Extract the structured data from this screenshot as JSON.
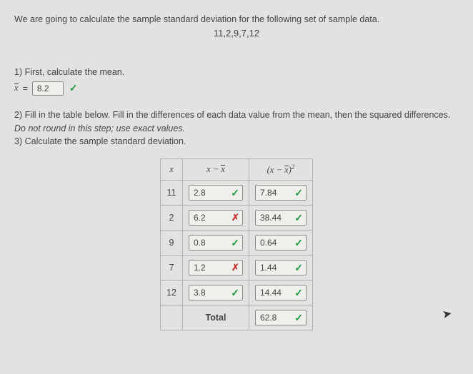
{
  "intro": "We are going to calculate the sample standard deviation for the following set of sample data.",
  "dataset": "11,2,9,7,12",
  "step1": {
    "label": "1) First, calculate the mean.",
    "symbol": "x",
    "eq": "=",
    "mean_value": "8.2",
    "mean_mark": "check"
  },
  "step2": {
    "line_a": "2) Fill in the table below. Fill in the differences of each data value from the mean, then the squared differences. ",
    "line_a_em": "Do not round in this step; use exact values.",
    "line_b": "3) Calculate the sample standard deviation."
  },
  "headers": {
    "x": "x",
    "diff": "x − x̄",
    "sq": "(x − x̄)"
  },
  "rows": [
    {
      "x": "11",
      "diff": "2.8",
      "diff_mark": "check",
      "sq": "7.84",
      "sq_mark": "check"
    },
    {
      "x": "2",
      "diff": "6.2",
      "diff_mark": "cross",
      "sq": "38.44",
      "sq_mark": "check"
    },
    {
      "x": "9",
      "diff": "0.8",
      "diff_mark": "check",
      "sq": "0.64",
      "sq_mark": "check"
    },
    {
      "x": "7",
      "diff": "1.2",
      "diff_mark": "cross",
      "sq": "1.44",
      "sq_mark": "check"
    },
    {
      "x": "12",
      "diff": "3.8",
      "diff_mark": "check",
      "sq": "14.44",
      "sq_mark": "check"
    }
  ],
  "total": {
    "label": "Total",
    "value": "62.8",
    "mark": "check"
  },
  "marks": {
    "check": "✓",
    "cross": "✗"
  },
  "chart_data": {
    "type": "table",
    "title": "Differences and squared differences from mean",
    "columns": [
      "x",
      "x - x̄",
      "(x - x̄)^2"
    ],
    "data": [
      [
        11,
        2.8,
        7.84
      ],
      [
        2,
        6.2,
        38.44
      ],
      [
        9,
        0.8,
        0.64
      ],
      [
        7,
        1.2,
        1.44
      ],
      [
        12,
        3.8,
        14.44
      ]
    ],
    "total_sq": 62.8,
    "mean": 8.2
  }
}
